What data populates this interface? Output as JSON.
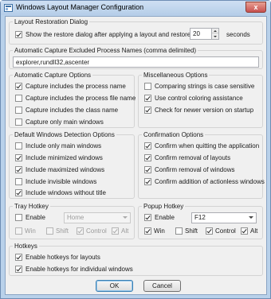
{
  "window": {
    "title": "Windows Layout Manager Configuration",
    "close_glyph": "x"
  },
  "layout_restoration": {
    "legend": "Layout Restoration Dialog",
    "show_restore_label": "Show the restore dialog after applying a layout and restore after",
    "show_restore_checked": true,
    "seconds_value": "20",
    "seconds_unit": "seconds"
  },
  "excluded_processes": {
    "legend": "Automatic Capture Excluded Process Names (comma delimited)",
    "value": "explorer,rundll32,ascenter"
  },
  "auto_capture": {
    "legend": "Automatic Capture Options",
    "items": [
      {
        "label": "Capture includes the process name",
        "checked": true
      },
      {
        "label": "Capture includes the process file name",
        "checked": false
      },
      {
        "label": "Capture includes the class name",
        "checked": false
      },
      {
        "label": "Capture only main windows",
        "checked": false
      }
    ]
  },
  "misc": {
    "legend": "Miscellaneous Options",
    "items": [
      {
        "label": "Comparing strings is case sensitive",
        "checked": false
      },
      {
        "label": "Use control coloring assistance",
        "checked": true
      },
      {
        "label": "Check for newer version on startup",
        "checked": true
      }
    ]
  },
  "detection": {
    "legend": "Default Windows Detection Options",
    "items": [
      {
        "label": "Include only main windows",
        "checked": false
      },
      {
        "label": "Include minimized windows",
        "checked": true
      },
      {
        "label": "Include maximized windows",
        "checked": true
      },
      {
        "label": "Include invisible windows",
        "checked": false
      },
      {
        "label": "Include windows without title",
        "checked": true
      }
    ]
  },
  "confirmation": {
    "legend": "Confirmation Options",
    "items": [
      {
        "label": "Confirm when quitting the application",
        "checked": true
      },
      {
        "label": "Confirm removal of layouts",
        "checked": true
      },
      {
        "label": "Confirm removal of windows",
        "checked": true
      },
      {
        "label": "Confirm addition of actionless windows",
        "checked": true
      }
    ]
  },
  "tray_hotkey": {
    "legend": "Tray Hotkey",
    "enable_label": "Enable",
    "enable_checked": false,
    "key_value": "Home",
    "modifiers": [
      {
        "label": "Win",
        "checked": false
      },
      {
        "label": "Shift",
        "checked": false
      },
      {
        "label": "Control",
        "checked": true
      },
      {
        "label": "Alt",
        "checked": true
      }
    ]
  },
  "popup_hotkey": {
    "legend": "Popup Hotkey",
    "enable_label": "Enable",
    "enable_checked": true,
    "key_value": "F12",
    "modifiers": [
      {
        "label": "Win",
        "checked": true
      },
      {
        "label": "Shift",
        "checked": false
      },
      {
        "label": "Control",
        "checked": true
      },
      {
        "label": "Alt",
        "checked": true
      }
    ]
  },
  "hotkeys": {
    "legend": "Hotkeys",
    "items": [
      {
        "label": "Enable hotkeys for layouts",
        "checked": true
      },
      {
        "label": "Enable hotkeys for individual windows",
        "checked": true
      }
    ]
  },
  "buttons": {
    "ok": "OK",
    "cancel": "Cancel"
  }
}
